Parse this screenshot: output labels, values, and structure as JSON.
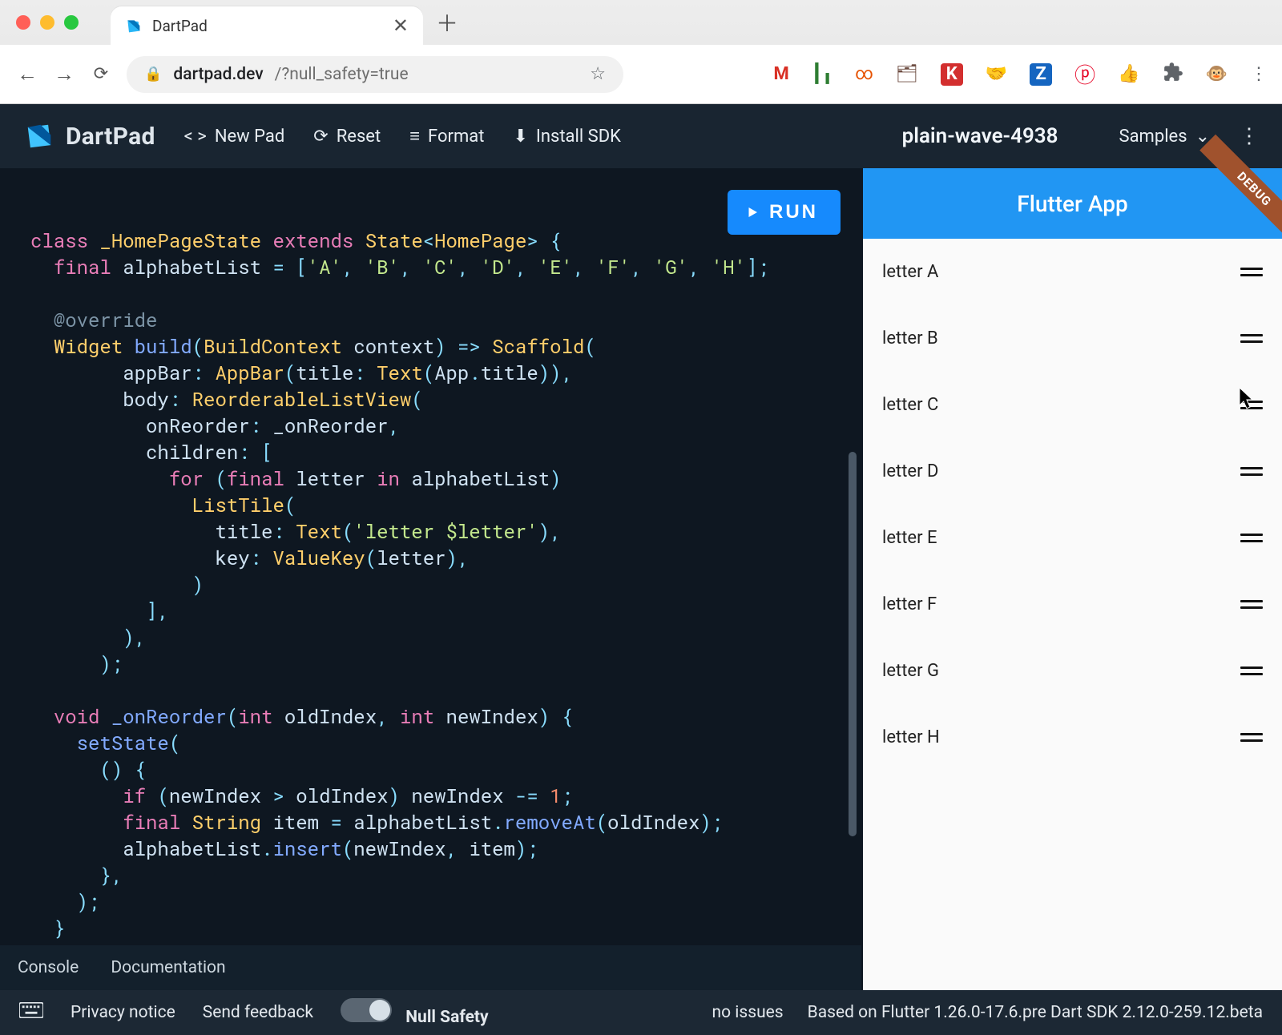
{
  "chrome": {
    "tab_title": "DartPad",
    "url_domain": "dartpad.dev",
    "url_path": "/?null_safety=true"
  },
  "dartpad": {
    "logo_text": "DartPad",
    "buttons": {
      "new_pad": "New Pad",
      "reset": "Reset",
      "format": "Format",
      "install_sdk": "Install SDK",
      "samples": "Samples",
      "run": "RUN"
    },
    "project_name": "plain-wave-4938",
    "tabs": {
      "console": "Console",
      "docs": "Documentation"
    },
    "code": {
      "raw": "class _HomePageState extends State<HomePage> {\n  final alphabetList = ['A', 'B', 'C', 'D', 'E', 'F', 'G', 'H'];\n\n  @override\n  Widget build(BuildContext context) => Scaffold(\n        appBar: AppBar(title: Text(App.title)),\n        body: ReorderableListView(\n          onReorder: _onReorder,\n          children: [\n            for (final letter in alphabetList)\n              ListTile(\n                title: Text('letter $letter'),\n                key: ValueKey(letter),\n              )\n          ],\n        ),\n      );\n\n  void _onReorder(int oldIndex, int newIndex) {\n    setState(\n      () {\n        if (newIndex > oldIndex) newIndex -= 1;\n        final String item = alphabetList.removeAt(oldIndex);\n        alphabetList.insert(newIndex, item);\n      },\n    );\n  }\n}"
    }
  },
  "flutter_preview": {
    "appbar_title": "Flutter App",
    "debug_banner": "DEBUG",
    "items": [
      "letter A",
      "letter B",
      "letter C",
      "letter D",
      "letter E",
      "letter F",
      "letter G",
      "letter H"
    ]
  },
  "footer": {
    "privacy": "Privacy notice",
    "feedback": "Send feedback",
    "null_safety": "Null Safety",
    "issues": "no issues",
    "version": "Based on Flutter 1.26.0-17.6.pre Dart SDK 2.12.0-259.12.beta"
  },
  "colors": {
    "accent": "#168afd",
    "flutter_blue": "#2196f3",
    "editor_bg": "#0e1721"
  }
}
